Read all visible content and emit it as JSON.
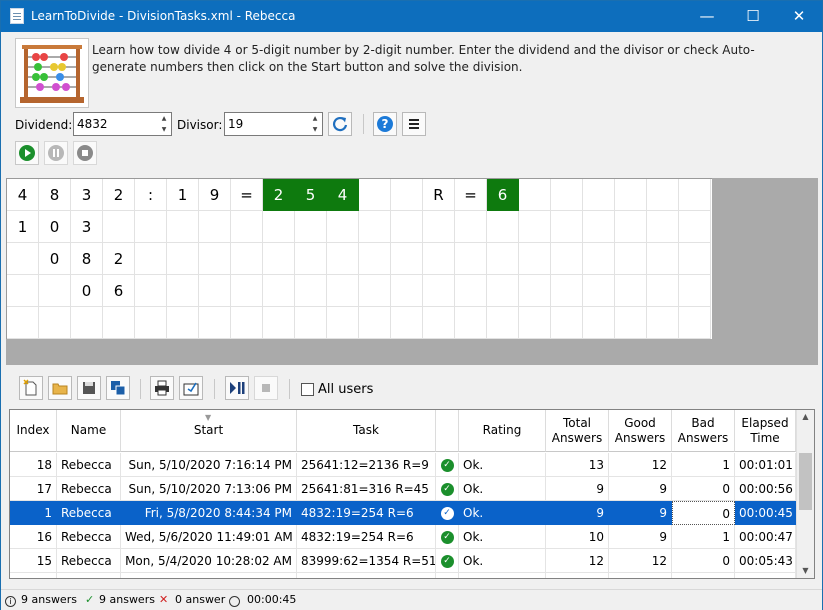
{
  "window": {
    "title": "LearnToDivide - DivisionTasks.xml - Rebecca",
    "minimize": "—",
    "maximize": "☐",
    "close": "✕"
  },
  "intro": "Learn how tow divide 4 or 5-digit number by 2-digit number. Enter the dividend and the divisor or check Auto-generate numbers then click on the Start button and solve the division.",
  "controls": {
    "dividend_label": "Dividend:",
    "dividend_value": "4832",
    "divisor_label": "Divisor:",
    "divisor_value": "19"
  },
  "grid": {
    "row1": [
      "4",
      "8",
      "3",
      "2",
      ":",
      "1",
      "9",
      "=",
      "2",
      "5",
      "4",
      "",
      "",
      "R",
      "=",
      "6"
    ],
    "row2": [
      "1",
      "0",
      "3"
    ],
    "row3": [
      "",
      "0",
      "8",
      "2"
    ],
    "row4": [
      "",
      "",
      "0",
      "6"
    ]
  },
  "toolbar": {
    "all_users_label": "All users"
  },
  "table": {
    "columns": [
      "Index",
      "Name",
      "Start",
      "Task",
      "",
      "Rating",
      "Total Answers",
      "Good Answers",
      "Bad Answers",
      "Elapsed Time"
    ],
    "rows": [
      {
        "index": "18",
        "name": "Rebecca",
        "start": "Sun, 5/10/2020 7:16:14 PM",
        "task": "25641:12=2136 R=9",
        "rating": "Ok.",
        "total": "13",
        "good": "12",
        "bad": "1",
        "elapsed": "00:01:01"
      },
      {
        "index": "17",
        "name": "Rebecca",
        "start": "Sun, 5/10/2020 7:13:06 PM",
        "task": "25641:81=316 R=45",
        "rating": "Ok.",
        "total": "9",
        "good": "9",
        "bad": "0",
        "elapsed": "00:00:56"
      },
      {
        "index": "1",
        "name": "Rebecca",
        "start": "Fri, 5/8/2020 8:44:34 PM",
        "task": "4832:19=254 R=6",
        "rating": "Ok.",
        "total": "9",
        "good": "9",
        "bad": "0",
        "elapsed": "00:00:45"
      },
      {
        "index": "16",
        "name": "Rebecca",
        "start": "Wed, 5/6/2020 11:49:01 AM",
        "task": "4832:19=254 R=6",
        "rating": "Ok.",
        "total": "10",
        "good": "9",
        "bad": "1",
        "elapsed": "00:00:47"
      },
      {
        "index": "15",
        "name": "Rebecca",
        "start": "Mon, 5/4/2020 10:28:02 AM",
        "task": "83999:62=1354 R=51",
        "rating": "Ok.",
        "total": "12",
        "good": "12",
        "bad": "0",
        "elapsed": "00:05:43"
      }
    ]
  },
  "status": {
    "answers": "9 answers",
    "good": "9 answers",
    "bad": "0 answer",
    "time": "00:00:45"
  }
}
